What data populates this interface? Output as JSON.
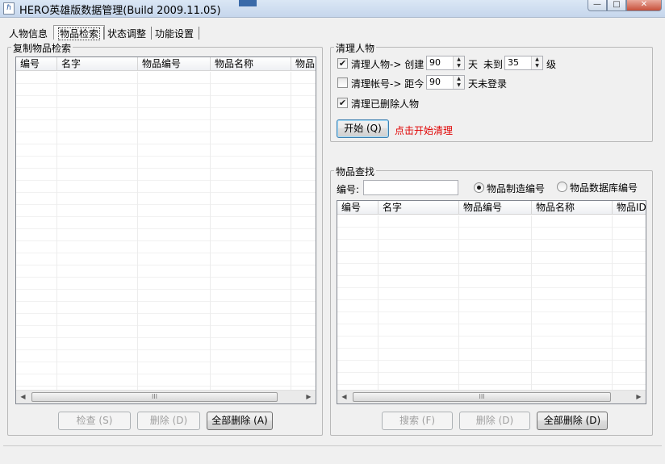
{
  "window": {
    "title": "HERO英雄版数据管理(Build 2009.11.05)",
    "min_symbol": "—",
    "max_symbol": "□",
    "close_symbol": "✕"
  },
  "tabs": [
    {
      "label": "人物信息"
    },
    {
      "label": "物品检索"
    },
    {
      "label": "状态调整"
    },
    {
      "label": "功能设置"
    }
  ],
  "copy_search": {
    "group_label": "复制物品检索",
    "columns": [
      "编号",
      "名字",
      "物品编号",
      "物品名称",
      "物品I"
    ],
    "buttons": {
      "check": "检查 (S)",
      "delete": "删除 (D)",
      "delete_all": "全部删除 (A)"
    }
  },
  "cleanup": {
    "group_label": "清理人物",
    "row1": {
      "checked": true,
      "label": "清理人物-> 创建",
      "days": "90",
      "unit": "天",
      "not_reach": "未到",
      "level": "35",
      "level_unit": "级"
    },
    "row2": {
      "checked": false,
      "label": "清理帐号-> 距今",
      "days": "90",
      "suffix": "天未登录"
    },
    "row3": {
      "checked": true,
      "label": "清理已删除人物"
    },
    "start_button": "开始 (Q)",
    "hint": "点击开始清理"
  },
  "item_find": {
    "group_label": "物品查找",
    "id_label": "编号:",
    "id_value": "",
    "radio_make": "物品制造编号",
    "radio_db": "物品数据库编号",
    "selected": "make",
    "columns": [
      "编号",
      "名字",
      "物品编号",
      "物品名称",
      "物品ID"
    ],
    "buttons": {
      "search": "搜索 (F)",
      "delete": "删除 (D)",
      "delete_all": "全部删除 (D)"
    }
  },
  "scroll": {
    "thumb_glyph": "III",
    "left_arrow": "◀",
    "right_arrow": "▶"
  }
}
